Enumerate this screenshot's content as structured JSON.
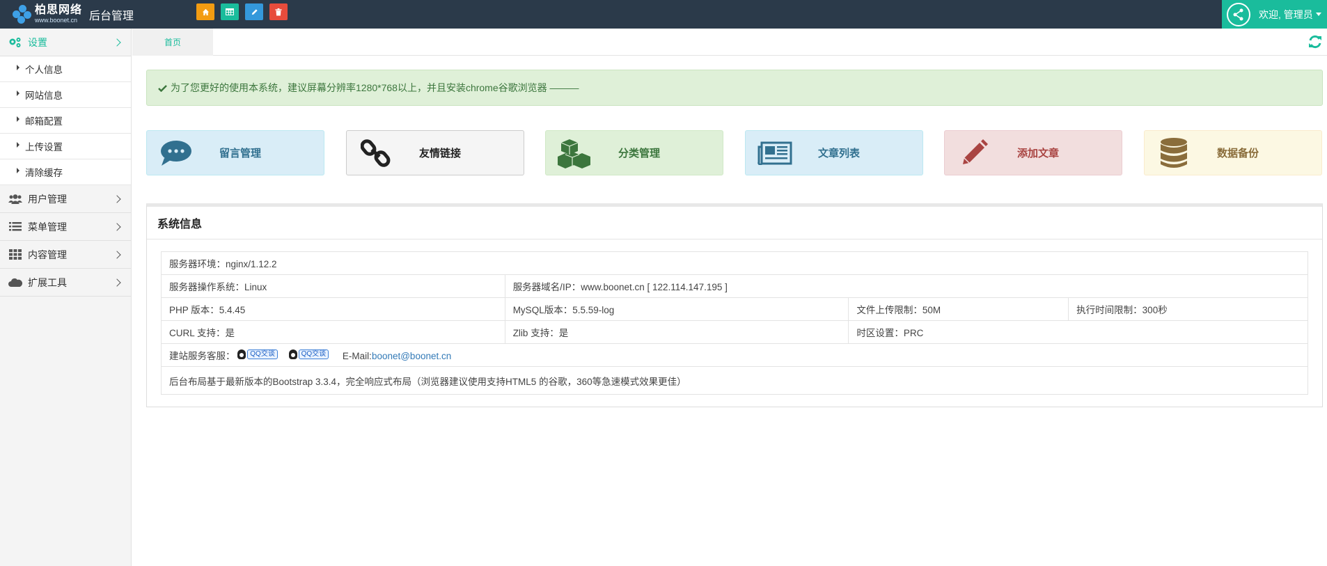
{
  "header": {
    "logo_cn": "柏思网络",
    "logo_url": "www.boonet.cn",
    "title": "后台管理",
    "quick_buttons": [
      {
        "icon": "home-icon",
        "color": "#f39c12"
      },
      {
        "icon": "grid-icon",
        "color": "#1abc9c"
      },
      {
        "icon": "pencil-icon",
        "color": "#3498db"
      },
      {
        "icon": "trash-icon",
        "color": "#e74c3c"
      }
    ],
    "user_label": "欢迎, 管理员",
    "accent": "#1abc9c",
    "bg": "#2b3a4a"
  },
  "sidebar": {
    "settings": {
      "label": "设置",
      "icon": "gears-icon"
    },
    "sub_items": [
      {
        "label": "个人信息"
      },
      {
        "label": "网站信息"
      },
      {
        "label": "邮箱配置"
      },
      {
        "label": "上传设置"
      },
      {
        "label": "清除缓存"
      }
    ],
    "groups": [
      {
        "label": "用户管理",
        "icon": "users-icon"
      },
      {
        "label": "菜单管理",
        "icon": "list-icon"
      },
      {
        "label": "内容管理",
        "icon": "th-icon"
      },
      {
        "label": "扩展工具",
        "icon": "cloud-icon"
      }
    ]
  },
  "tabs": {
    "home": "首页",
    "refresh_icon": "refresh-icon"
  },
  "notice": {
    "text": "为了您更好的使用本系统，建议屏幕分辨率1280*768以上，并且安装chrome谷歌浏览器 ———"
  },
  "cards": [
    {
      "label": "留言管理",
      "icon": "comments-icon",
      "bg": "#d9edf7",
      "border": "#bce8f1",
      "color": "#31708f"
    },
    {
      "label": "友情链接",
      "icon": "link-icon",
      "bg": "#f5f5f5",
      "border": "#cccccc",
      "color": "#222222"
    },
    {
      "label": "分类管理",
      "icon": "cubes-icon",
      "bg": "#dff0d8",
      "border": "#d0e9c6",
      "color": "#3c763d"
    },
    {
      "label": "文章列表",
      "icon": "newspaper-icon",
      "bg": "#d9edf7",
      "border": "#bce8f1",
      "color": "#31708f"
    },
    {
      "label": "添加文章",
      "icon": "pencil-icon",
      "bg": "#f2dede",
      "border": "#ebccd1",
      "color": "#a94442"
    },
    {
      "label": "数据备份",
      "icon": "database-icon",
      "bg": "#fcf8e3",
      "border": "#faebcc",
      "color": "#8a6d3b"
    }
  ],
  "system_info": {
    "title": "系统信息",
    "server_env": "服务器环境：nginx/1.12.2",
    "server_os": "服务器操作系统：Linux",
    "server_domain": "服务器域名/IP：www.boonet.cn [ 122.114.147.195 ]",
    "php": "PHP 版本：5.4.45",
    "mysql": "MySQL版本：5.5.59-log",
    "upload_limit": "文件上传限制：50M",
    "exec_limit": "执行时间限制：300秒",
    "curl": "CURL 支持：是",
    "zlib": "Zlib 支持：是",
    "timezone": "时区设置：PRC",
    "support_label": "建站服务客服：",
    "qq_label": "QQ交谈",
    "email_label": "E-Mail:",
    "email": "boonet@boonet.cn",
    "footer": "后台布局基于最新版本的Bootstrap 3.3.4，完全响应式布局（浏览器建议使用支持HTML5 的谷歌，360等急速模式效果更佳）"
  }
}
